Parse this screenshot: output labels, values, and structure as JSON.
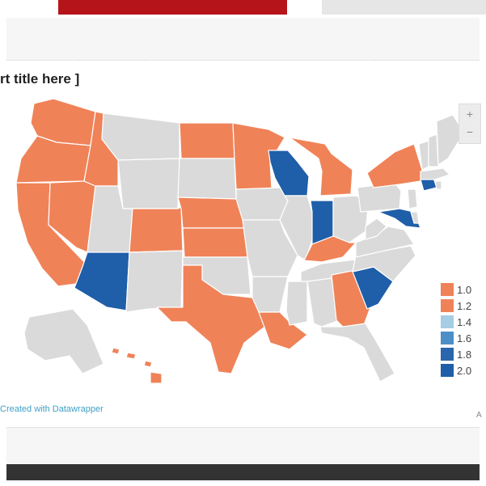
{
  "chart": {
    "title": "rt title here ]",
    "credit": "Created with Datawrapper",
    "corner_mark": "A"
  },
  "colors": {
    "orange": "#f08258",
    "dark_blue": "#1f5ea8",
    "gray": "#dadada",
    "red_strip": "#b5141b"
  },
  "legend": [
    {
      "label": "1.0",
      "color": "#f08258"
    },
    {
      "label": "1.2",
      "color": "#f08258"
    },
    {
      "label": "1.4",
      "color": "#a5cde5"
    },
    {
      "label": "1.6",
      "color": "#4c8fc7"
    },
    {
      "label": "1.8",
      "color": "#2a66ad"
    },
    {
      "label": "2.0",
      "color": "#1f5ea8"
    }
  ],
  "zoom": {
    "plus": "+",
    "minus": "−"
  },
  "chart_data": {
    "type": "choropleth",
    "region": "United States",
    "states_value_1": [
      "WA",
      "OR",
      "CA",
      "ID",
      "NV",
      "CO",
      "ND",
      "NE",
      "KS",
      "MN",
      "TX",
      "LA",
      "MI",
      "KY",
      "GA",
      "NY",
      "HI"
    ],
    "states_value_2": [
      "AZ",
      "WI",
      "IN",
      "SC",
      "MD",
      "CT"
    ],
    "states_no_data": [
      "MT",
      "WY",
      "UT",
      "NM",
      "SD",
      "OK",
      "IA",
      "MO",
      "AR",
      "MS",
      "AL",
      "IL",
      "OH",
      "TN",
      "WV",
      "VA",
      "NC",
      "FL",
      "PA",
      "NJ",
      "DE",
      "ME",
      "NH",
      "VT",
      "MA",
      "RI",
      "AK"
    ]
  }
}
